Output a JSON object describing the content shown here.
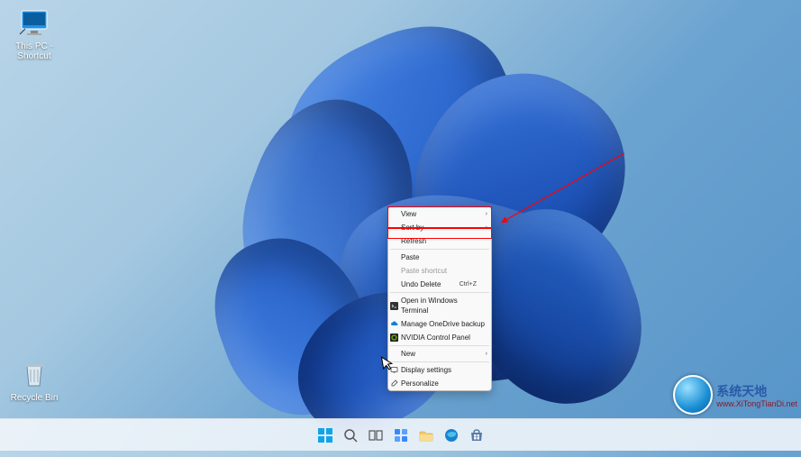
{
  "desktop": {
    "icons": {
      "this_pc": "This PC - Shortcut",
      "recycle": "Recycle Bin"
    }
  },
  "context_menu": {
    "view": "View",
    "sort_by": "Sort by",
    "refresh": "Refresh",
    "paste": "Paste",
    "paste_shortcut": "Paste shortcut",
    "undo_delete": "Undo Delete",
    "undo_shortcut": "Ctrl+Z",
    "open_terminal": "Open in Windows Terminal",
    "onedrive": "Manage OneDrive backup",
    "nvidia": "NVIDIA Control Panel",
    "new": "New",
    "display": "Display settings",
    "personalize": "Personalize"
  },
  "icons": {
    "chevron": "›",
    "terminal": "▣",
    "cloud": "☁",
    "nvidia_badge": "◉",
    "display_icon": "🖵",
    "personalize_icon": "🎨"
  },
  "taskbar": {
    "start": "start-icon",
    "search": "search-icon",
    "taskview": "taskview-icon",
    "widgets": "widgets-icon",
    "explorer": "file-explorer-icon",
    "edge": "edge-icon",
    "store": "store-icon"
  },
  "watermark": {
    "title": "系统天地",
    "url": "www.XiTongTianDi.net"
  }
}
